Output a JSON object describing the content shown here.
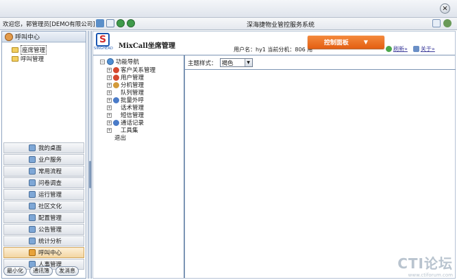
{
  "header": {
    "welcome": "欢迎您，郭管理员[DEMO有限公司]",
    "system_title": "深海捷物业管控服务系统",
    "close_glyph": "×"
  },
  "sidebar": {
    "title": "呼叫中心",
    "tree": [
      {
        "label": "座席管理",
        "selected": true
      },
      {
        "label": "呼叫管理",
        "selected": false
      }
    ],
    "menu": [
      {
        "label": "我的桌面",
        "active": false
      },
      {
        "label": "业户服务",
        "active": false
      },
      {
        "label": "常用流程",
        "active": false
      },
      {
        "label": "问卷调查",
        "active": false
      },
      {
        "label": "运行管理",
        "active": false
      },
      {
        "label": "社区文化",
        "active": false
      },
      {
        "label": "配置管理",
        "active": false
      },
      {
        "label": "公告管理",
        "active": false
      },
      {
        "label": "统计分析",
        "active": false
      },
      {
        "label": "呼叫中心",
        "active": true
      },
      {
        "label": "人事管理",
        "active": false
      }
    ],
    "buttons": {
      "minimize": "最小化",
      "address_book": "通讯簿",
      "send_message": "发消息"
    }
  },
  "main": {
    "logo_text": "SINGHEAD",
    "logo_glyph": "S",
    "app_title": "MixCall坐席管理",
    "user_info": "用户名：hy1  当前分机：806",
    "user_info_trunc": "用",
    "control_panel": "控制面板",
    "caret": "▼",
    "refresh": "刷新»",
    "about": "关于»",
    "nav_root": "功能导航",
    "nav_items": [
      {
        "label": "客户关系管理",
        "icon": "red",
        "expandable": true
      },
      {
        "label": "用户管理",
        "icon": "red",
        "expandable": true
      },
      {
        "label": "分机管理",
        "icon": "person",
        "expandable": true
      },
      {
        "label": "队列管理",
        "icon": "none",
        "expandable": true
      },
      {
        "label": "批量外呼",
        "icon": "multi",
        "expandable": true
      },
      {
        "label": "话术管理",
        "icon": "none",
        "expandable": true
      },
      {
        "label": "短信管理",
        "icon": "none",
        "expandable": true
      },
      {
        "label": "通话记录",
        "icon": "multi",
        "expandable": true
      },
      {
        "label": "工具集",
        "icon": "none",
        "expandable": true
      },
      {
        "label": "退出",
        "icon": "none",
        "expandable": false
      }
    ],
    "theme_label": "主题样式：",
    "theme_value": "褐色",
    "select_arrow": "▼"
  },
  "watermark": {
    "big": "CTI论坛",
    "small": "www.ctiforum.com"
  },
  "colors": {
    "accent_orange": "#e45f12",
    "border_blue": "#7a93b3",
    "logo_blue": "#1a57b2"
  }
}
